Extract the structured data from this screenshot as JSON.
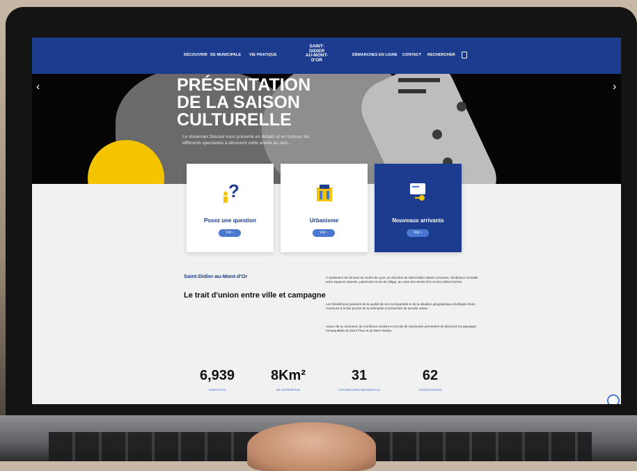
{
  "nav": {
    "links": [
      "DÉCOUVRIR",
      "DE MUNICIPALE",
      "VIE PRATIQUE",
      "DÉMARCHES EN LIGNE",
      "CONTACT",
      "RECHERCHER"
    ],
    "logo_lines": [
      "SAINT-",
      "DIDIER",
      "AU-MONT-",
      "D'OR"
    ]
  },
  "hero": {
    "title_lines": [
      "PRÉSENTATION",
      "DE LA SAISON",
      "CULTURELLE"
    ],
    "text": "Le showman Stécoul vous présente en détails et en humour les différents spectacles à découvrir cette année au sein..."
  },
  "cards": [
    {
      "title": "Posez une question",
      "button": "Voir ›",
      "icon": "question-icon"
    },
    {
      "title": "Urbanisme",
      "button": "Voir ›",
      "icon": "building-icon"
    },
    {
      "title": "Nouveaux arrivants",
      "button": "Voir ›",
      "icon": "key-card-icon"
    }
  ],
  "intro": {
    "subtitle": "Saint-Didier-au-Mont-d'Or",
    "heading": "Le trait d'union entre ville et campagne",
    "paragraphs": [
      "À seulement 20 minutes du centre de Lyon, en direction de Saint-Didier depuis Limonest, l'ambiance s'installe entre espaces naturels, patrimoine et vie de village, au cœur des Monts d'Or et des vallons boisés.",
      "Les Désidériens jouissent de la qualité de vie incomparable et de la situation géographique privilégiée d'une commune à la fois proche de la métropole et préservée du tumulte urbain.",
      "Autour de la commune, de nombreux sentiers et circuits de randonnée permettent de découvrir les paysages remarquables du Mont Thou et du Mont Verdun."
    ]
  },
  "stats": [
    {
      "value": "6,939",
      "label": "HABITANTS"
    },
    {
      "value": "8Km²",
      "label": "DE SUPERFICIE"
    },
    {
      "value": "31",
      "label": "CONSEILLERS MUNICIPAUX"
    },
    {
      "value": "62",
      "label": "ASSOCIATIONS"
    }
  ],
  "colors": {
    "brand": "#1b3c8f",
    "accent": "#4a78d1",
    "yellow": "#f4c400"
  }
}
